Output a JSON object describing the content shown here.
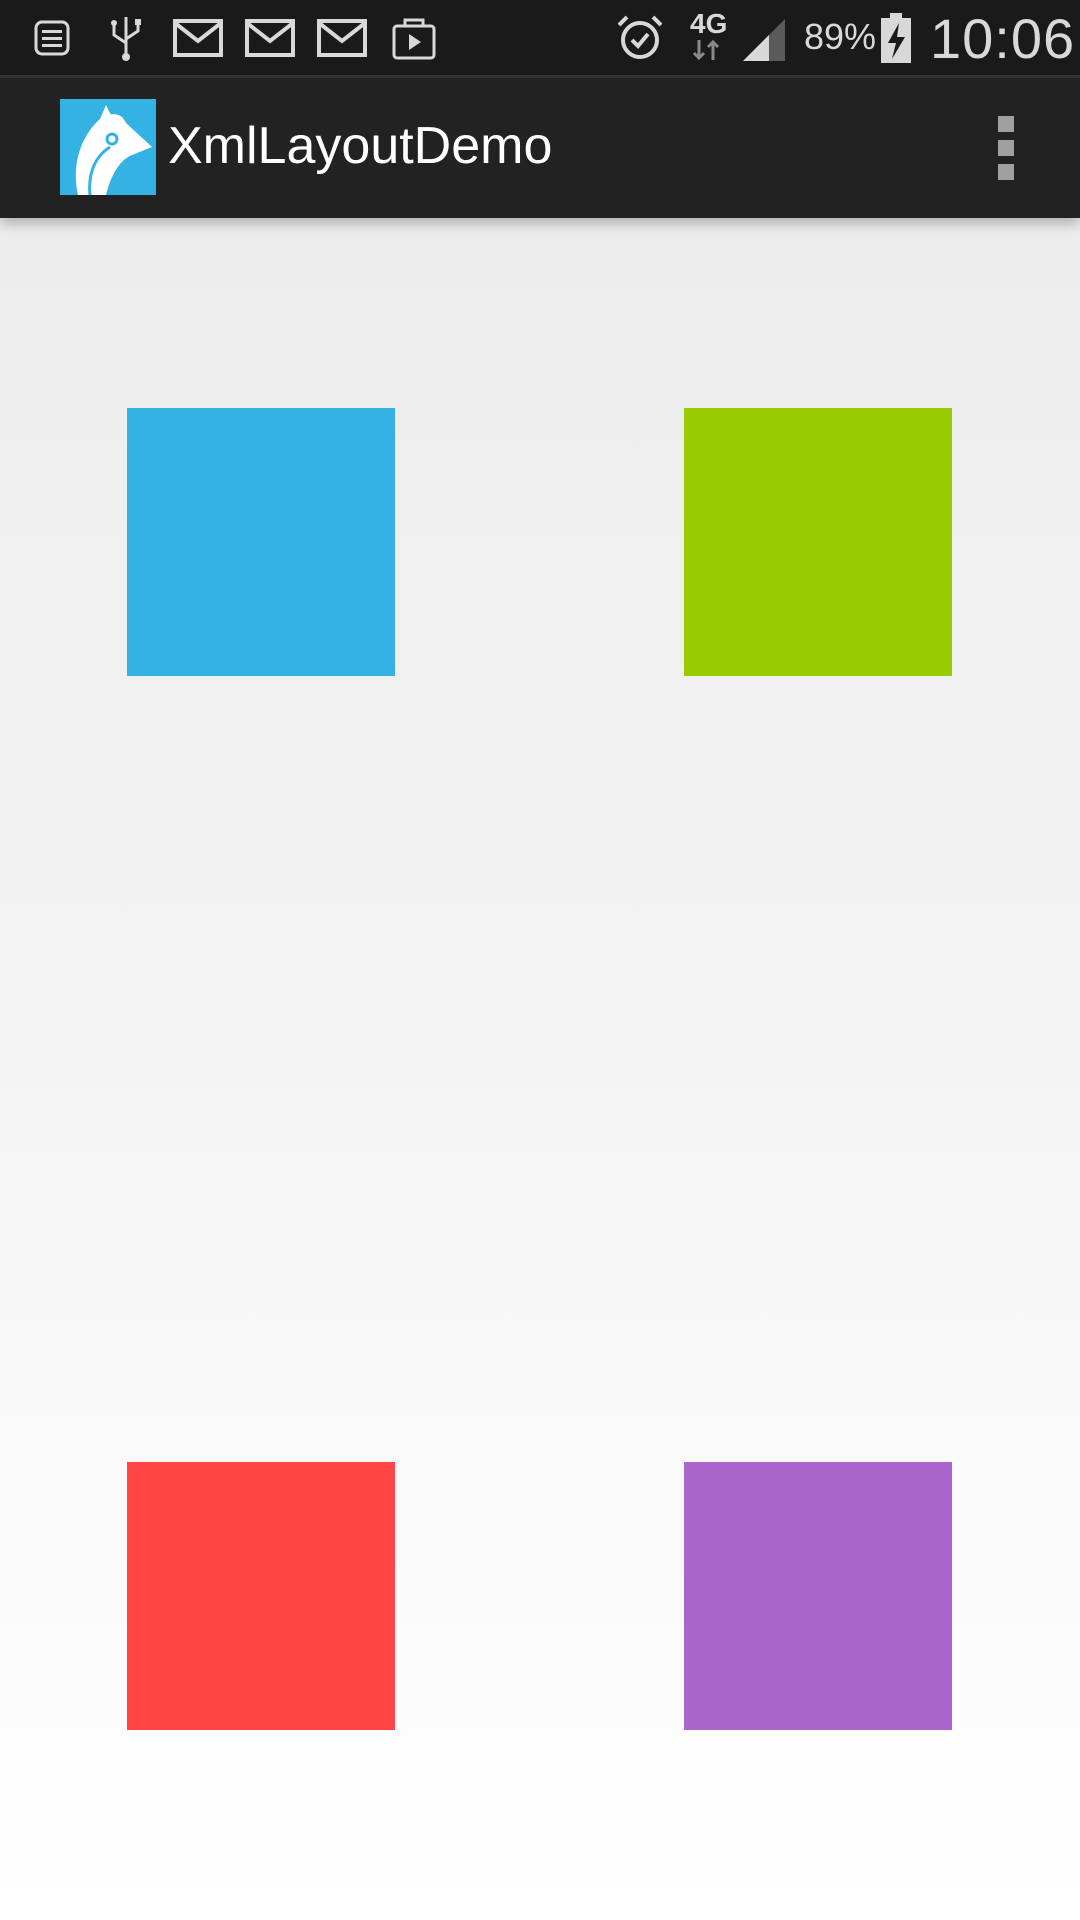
{
  "status_bar": {
    "notification_icons": [
      "notifications-list-icon",
      "usb-icon",
      "gmail-icon",
      "gmail-icon",
      "gmail-icon",
      "play-store-icon"
    ],
    "status_icons": [
      "alarm-icon",
      "network-icon",
      "signal-icon",
      "battery-charging-icon"
    ],
    "network_type": "4G",
    "battery_percent": "89%",
    "time": "10:06"
  },
  "action_bar": {
    "app_icon": "app-logo-icon",
    "title": "XmlLayoutDemo",
    "overflow_icon": "overflow-menu-icon"
  },
  "content": {
    "squares": [
      {
        "name": "blue",
        "color": "#35b2e4"
      },
      {
        "name": "green",
        "color": "#99cc00"
      },
      {
        "name": "red",
        "color": "#ff4444"
      },
      {
        "name": "purple",
        "color": "#aa66cc"
      }
    ]
  }
}
